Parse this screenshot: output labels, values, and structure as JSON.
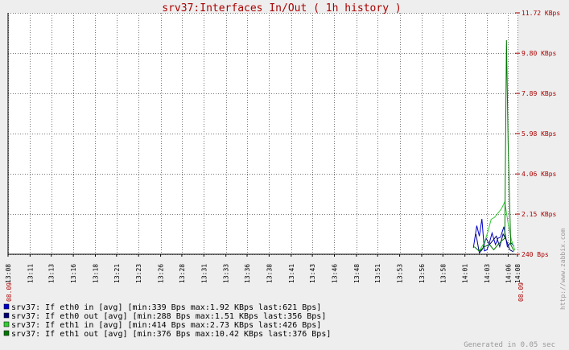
{
  "chart_data": {
    "type": "line",
    "title": "srv37:Interfaces In/Out ( 1h history )",
    "y_ticks": [
      "240 Bps",
      "2.15 KBps",
      "4.06 KBps",
      "5.98 KBps",
      "7.89 KBps",
      "9.80 KBps",
      "11.72 KBps"
    ],
    "y_tick_values": [
      0.24,
      2.15,
      4.06,
      5.98,
      7.89,
      9.8,
      11.72
    ],
    "ylim": [
      0.24,
      11.72
    ],
    "y_unit": "KBps",
    "x_ticks": [
      "13:08",
      "13:11",
      "13:13",
      "13:16",
      "13:18",
      "13:21",
      "13:23",
      "13:26",
      "13:28",
      "13:31",
      "13:33",
      "13:36",
      "13:38",
      "13:41",
      "13:43",
      "13:46",
      "13:48",
      "13:51",
      "13:53",
      "13:56",
      "13:58",
      "14:01",
      "14:03",
      "14:06",
      "14:08"
    ],
    "x_tick_minutes": [
      0,
      2.6,
      5.1,
      7.7,
      10.3,
      12.8,
      15.4,
      18.0,
      20.5,
      23.1,
      25.7,
      28.2,
      30.8,
      33.4,
      35.9,
      38.5,
      41.1,
      43.6,
      46.2,
      48.8,
      51.3,
      53.9,
      56.5,
      59.0,
      60.1
    ],
    "xlim": [
      0,
      60.1
    ],
    "start_date": "08.09",
    "end_date": "08.09",
    "grid": true,
    "series": [
      {
        "name": "srv37: If eth0 in",
        "color": "#0000cc",
        "x": [
          54.9,
          55.3,
          55.6,
          55.9,
          56.2,
          56.5,
          56.8,
          57.1,
          57.5,
          57.8,
          58.1,
          58.5,
          58.9,
          59.3,
          59.7
        ],
        "values": [
          0.55,
          1.6,
          1.1,
          1.92,
          0.4,
          0.45,
          0.8,
          1.25,
          0.7,
          1.0,
          1.05,
          1.55,
          0.6,
          0.8,
          0.62
        ]
      },
      {
        "name": "srv37: If eth0 out",
        "color": "#000077",
        "x": [
          55.2,
          55.6,
          56.0,
          56.4,
          56.8,
          57.2,
          57.6,
          58.0,
          58.4,
          58.8,
          59.2,
          59.6
        ],
        "values": [
          1.2,
          0.3,
          0.5,
          1.0,
          0.7,
          0.9,
          1.1,
          0.6,
          1.2,
          0.9,
          0.45,
          0.36
        ]
      },
      {
        "name": "srv37: If eth1 in",
        "color": "#33cc33",
        "x": [
          55.6,
          56.2,
          56.6,
          57.0,
          57.4,
          57.8,
          58.2,
          58.6,
          59.0,
          59.4,
          59.8
        ],
        "values": [
          0.41,
          0.8,
          1.3,
          1.9,
          2.0,
          2.2,
          2.4,
          2.73,
          1.7,
          0.9,
          0.43
        ]
      },
      {
        "name": "srv37: If eth1 out",
        "color": "#007700",
        "x": [
          55.0,
          55.6,
          56.2,
          56.8,
          57.3,
          57.8,
          58.3,
          58.6,
          58.8,
          59.0,
          59.3,
          59.7
        ],
        "values": [
          0.6,
          0.38,
          0.6,
          0.7,
          0.45,
          0.7,
          0.9,
          1.0,
          10.42,
          5.5,
          0.7,
          0.38
        ]
      }
    ],
    "legend": [
      {
        "color": "#0000cc",
        "text": "srv37: If eth0 in  [avg] [min:339 Bps max:1.92 KBps last:621 Bps]"
      },
      {
        "color": "#000077",
        "text": "srv37: If eth0 out [avg] [min:288 Bps max:1.51 KBps last:356 Bps]"
      },
      {
        "color": "#33cc33",
        "text": "srv37: If eth1 in  [avg] [min:414 Bps max:2.73 KBps last:426 Bps]"
      },
      {
        "color": "#007700",
        "text": "srv37: If eth1 out [avg] [min:376 Bps max:10.42 KBps last:376 Bps]"
      }
    ],
    "legend_position": "bottom-left",
    "footer": "Generated in 0.05 sec",
    "watermark": "http://www.zabbix.com",
    "colors": {
      "background": "#eeeeee",
      "plot": "#ffffff",
      "grid": "#777777",
      "title": "#aa0000",
      "y_ticks": "#aa0000",
      "x_ticks": "#000000",
      "date": "#aa0000",
      "footer": "#999999",
      "watermark": "#999999"
    }
  }
}
